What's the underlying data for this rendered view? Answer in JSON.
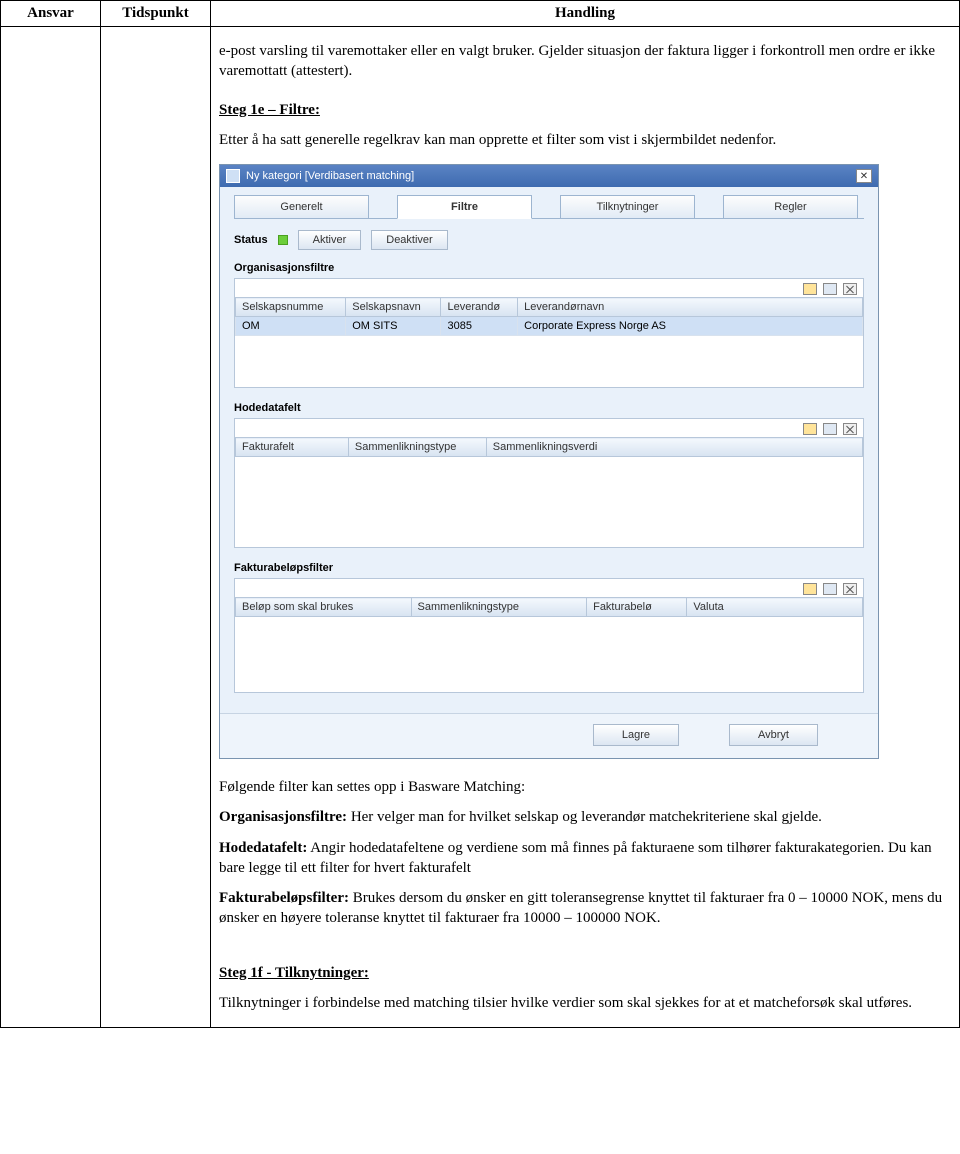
{
  "outer": {
    "headers": {
      "ansvar": "Ansvar",
      "tidspunkt": "Tidspunkt",
      "handling": "Handling"
    }
  },
  "doc": {
    "intro": "e-post varsling til varemottaker eller en valgt bruker. Gjelder situasjon der faktura ligger i forkontroll men ordre er ikke varemottatt (attestert).",
    "step1e_title": "Steg 1e – Filtre:",
    "step1e_body": "Etter å ha satt generelle regelkrav kan man opprette et filter som vist i skjermbildet nedenfor.",
    "after_intro": "Følgende filter kan settes opp i Basware Matching:",
    "org_label": "Organisasjonsfiltre:",
    "org_text": " Her velger man for hvilket selskap og leverandør matchekriteriene skal gjelde.",
    "hode_label": "Hodedatafelt:",
    "hode_text": " Angir hodedatafeltene og verdiene som må finnes på fakturaene som tilhører fakturakategorien. Du kan bare legge til ett filter for hvert fakturafelt",
    "belop_label": "Fakturabeløpsfilter:",
    "belop_text": " Brukes dersom du ønsker en gitt toleransegrense knyttet til fakturaer fra 0 – 10000 NOK, mens du ønsker en høyere toleranse knyttet til fakturaer fra 10000 – 100000 NOK.",
    "step1f_title": "Steg 1f - Tilknytninger:",
    "step1f_body": "Tilknytninger i forbindelse med matching tilsier hvilke verdier som skal sjekkes for at et matcheforsøk skal utføres."
  },
  "app": {
    "title": "Ny kategori [Verdibasert matching]",
    "tabs": {
      "t1": "Generelt",
      "t2": "Filtre",
      "t3": "Tilknytninger",
      "t4": "Regler"
    },
    "status_label": "Status",
    "btn_aktiver": "Aktiver",
    "btn_deaktiver": "Deaktiver",
    "sec_org": "Organisasjonsfiltre",
    "sec_hode": "Hodedatafelt",
    "sec_belop": "Fakturabeløpsfilter",
    "org_headers": {
      "c1": "Selskapsnumme",
      "c2": "Selskapsnavn",
      "c3": "Leverandø",
      "c4": "Leverandørnavn"
    },
    "org_row": {
      "c1": "OM",
      "c2": "OM SITS",
      "c3": "3085",
      "c4": "Corporate Express Norge AS"
    },
    "hode_headers": {
      "c1": "Fakturafelt",
      "c2": "Sammenlikningstype",
      "c3": "Sammenlikningsverdi"
    },
    "belop_headers": {
      "c1": "Beløp som skal brukes",
      "c2": "Sammenlikningstype",
      "c3": "Fakturabelø",
      "c4": "Valuta"
    },
    "btn_lagre": "Lagre",
    "btn_avbryt": "Avbryt"
  }
}
